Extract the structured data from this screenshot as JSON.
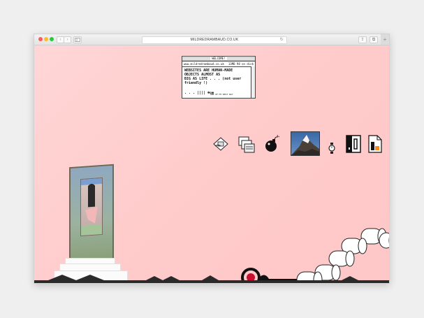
{
  "browser": {
    "url": "MILDREDRAMBAUD.CO.UK",
    "reload_glyph": "↻",
    "back_glyph": "‹",
    "forward_glyph": "›",
    "share_glyph": "⇪",
    "tabs_glyph": "⧉",
    "new_tab_glyph": "+"
  },
  "welcome_window": {
    "title": "WELCOME!",
    "address": "www.mildredrambaud.co.uk",
    "disk": "13MB 98 on disk",
    "line1": "WEBSITES ARE HUMAN-MADE",
    "line2": "OBJECTS ALMOST AS",
    "line3": "BIG AS LIFE . . . (not user friendly !)",
    "footer": ". . . |||| ☻❂◉",
    "small": "ONE OF MY BEST WAY"
  },
  "colors": {
    "page_bg": "#ffcccc",
    "accent_red": "#c8102e"
  },
  "icons": [
    "hand-card-icon",
    "folder-stack-icon",
    "bomb-icon",
    "matterhorn-image",
    "watch-icon",
    "mac-disk-icon",
    "document-icon"
  ]
}
